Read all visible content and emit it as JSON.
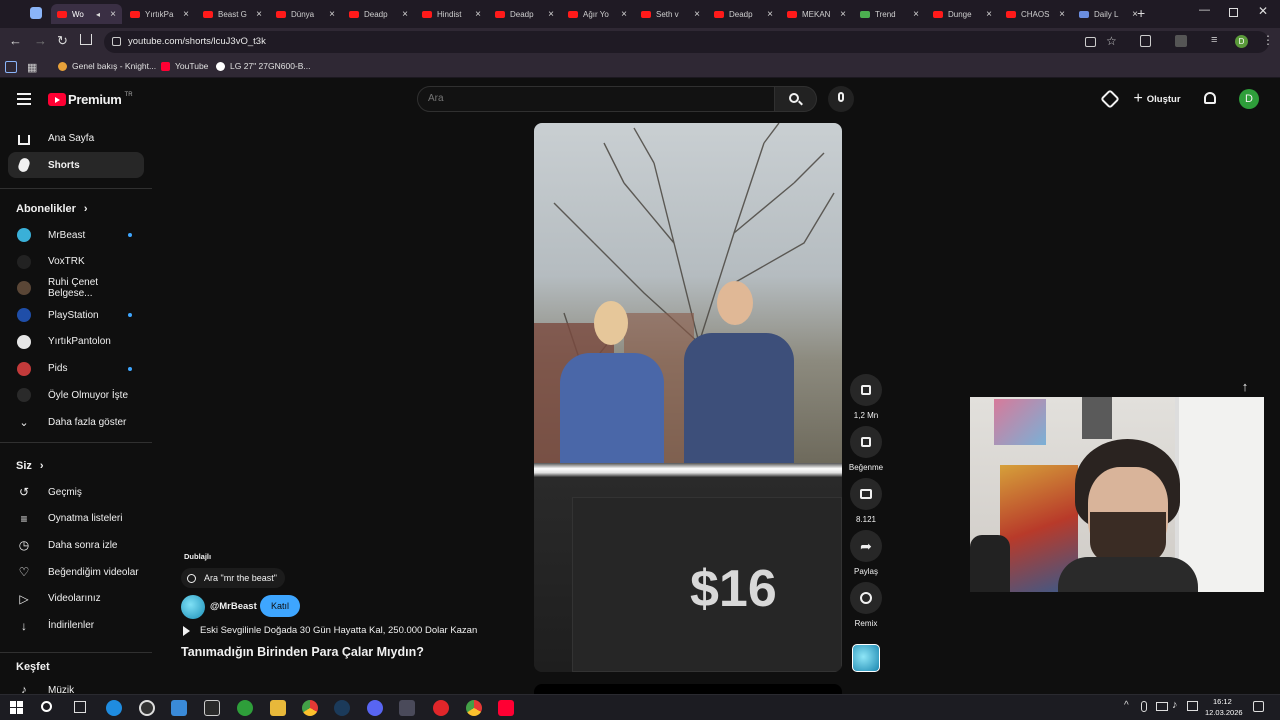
{
  "browser": {
    "tabs": [
      {
        "label": "Wo",
        "active": true
      },
      {
        "label": "YırtıkPa"
      },
      {
        "label": "Beast G"
      },
      {
        "label": "Dünya"
      },
      {
        "label": "Deadp"
      },
      {
        "label": "Hindist"
      },
      {
        "label": "Deadp"
      },
      {
        "label": "Ağır Yo"
      },
      {
        "label": "Seth v"
      },
      {
        "label": "Deadp"
      },
      {
        "label": "MEKAN"
      },
      {
        "label": "Trend"
      },
      {
        "label": "Dunge"
      },
      {
        "label": "CHAOS"
      },
      {
        "label": "Daily L"
      }
    ],
    "url": "youtube.com/shorts/lcuJ3vO_t3k",
    "bookmarks": [
      {
        "label": "Genel bakış - Knight..."
      },
      {
        "label": "YouTube"
      },
      {
        "label": "LG 27\" 27GN600-B..."
      }
    ],
    "profile_initial": "D"
  },
  "youtube": {
    "logo_text": "Premium",
    "logo_sup": "TR",
    "search_placeholder": "Ara",
    "create_label": "Oluştur",
    "avatar_initial": "D",
    "nav": [
      {
        "label": "Ana Sayfa",
        "icon": "home-icon"
      },
      {
        "label": "Shorts",
        "icon": "shorts-icon",
        "selected": true
      }
    ],
    "subscriptions_title": "Abonelikler",
    "subscriptions": [
      {
        "label": "MrBeast",
        "color": "#3ab0d8",
        "dot": true
      },
      {
        "label": "VoxTRK",
        "color": "#222222",
        "dot": false
      },
      {
        "label": "Ruhi Çenet Belgese...",
        "color": "#5a4636",
        "dot": false
      },
      {
        "label": "PlayStation",
        "color": "#1f4ea8",
        "dot": true
      },
      {
        "label": "YırtıkPantolon",
        "color": "#e6e6e6",
        "dot": false
      },
      {
        "label": "Pids",
        "color": "#c23a3a",
        "dot": true
      },
      {
        "label": "Öyle Olmuyor İşte",
        "color": "#2a2a2a",
        "dot": false
      }
    ],
    "show_more_label": "Daha fazla göster",
    "you_title": "Siz",
    "you_items": [
      {
        "label": "Geçmiş",
        "icon": "history-icon"
      },
      {
        "label": "Oynatma listeleri",
        "icon": "playlist-icon"
      },
      {
        "label": "Daha sonra izle",
        "icon": "clock-icon"
      },
      {
        "label": "Beğendiğim videolar",
        "icon": "like-icon"
      },
      {
        "label": "Videolarınız",
        "icon": "video-icon"
      },
      {
        "label": "İndirilenler",
        "icon": "download-icon"
      }
    ],
    "explore_title": "Keşfet",
    "explore_items": [
      {
        "label": "Müzik",
        "icon": "music-icon"
      }
    ],
    "short": {
      "dubbed_label": "Dublajlı",
      "search_chip": "Ara \"mr the beast\"",
      "channel_handle": "@MrBeast",
      "join_label": "Katıl",
      "related_title": "Eski Sevgilinle Doğada 30 Gün Hayatta Kal, 250.000 Dolar Kazan",
      "title": "Tanımadığın Birinden Para Çalar Mıydın?",
      "price_on_screen": "$16",
      "actions": {
        "likes": "1,2 Mn",
        "dislike": "Beğenme",
        "comments": "8.121",
        "share": "Paylaş",
        "remix": "Remix"
      }
    }
  },
  "taskbar": {
    "time": "16:12",
    "date": "12.03.2026"
  },
  "colors": {
    "yt_red": "#ff0033",
    "accent_blue": "#3ea6ff",
    "avatar_green": "#2e9e3a"
  }
}
